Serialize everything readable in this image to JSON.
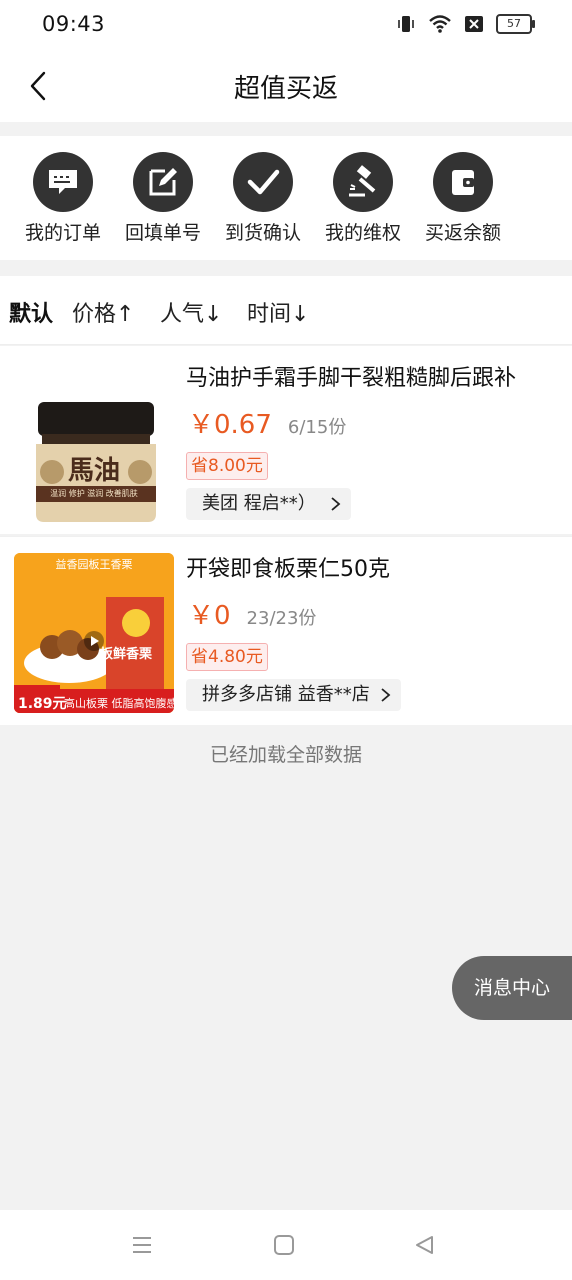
{
  "status_bar": {
    "time": "09:43",
    "battery": "57"
  },
  "nav": {
    "title": "超值买返"
  },
  "quick_menu": [
    {
      "label": "我的订单",
      "icon": "order-list-icon"
    },
    {
      "label": "回填单号",
      "icon": "edit-icon"
    },
    {
      "label": "到货确认",
      "icon": "check-icon"
    },
    {
      "label": "我的维权",
      "icon": "gavel-icon"
    },
    {
      "label": "买返余额",
      "icon": "wallet-icon"
    }
  ],
  "sort": [
    {
      "label": "默认",
      "active": true
    },
    {
      "label": "价格↑"
    },
    {
      "label": "人气↓"
    },
    {
      "label": "时间↓"
    }
  ],
  "products": [
    {
      "title": "马油护手霜手脚干裂粗糙脚后跟补",
      "price": "￥0.67",
      "stock": "6/15份",
      "save": "省8.00元",
      "store": "美团 程启**）",
      "img_text": "馬油",
      "img_subtext": "温润 修护 滋润 改善肌肤"
    },
    {
      "title": "开袋即食板栗仁50克",
      "price": "￥0",
      "stock": "23/23份",
      "save": "省4.80元",
      "store": "拼多多店铺 益香**店",
      "img_text": "益香园板王香栗",
      "img_badge_price": "1.89元",
      "img_banner": "高山板栗 低脂高饱腹感",
      "img_pack": "板鲜香栗"
    }
  ],
  "load_end": "已经加载全部数据",
  "float_button": "消息中心",
  "colors": {
    "accent": "#e85a22",
    "icon_bg": "#333333",
    "badge_bg": "#fdeeee"
  }
}
